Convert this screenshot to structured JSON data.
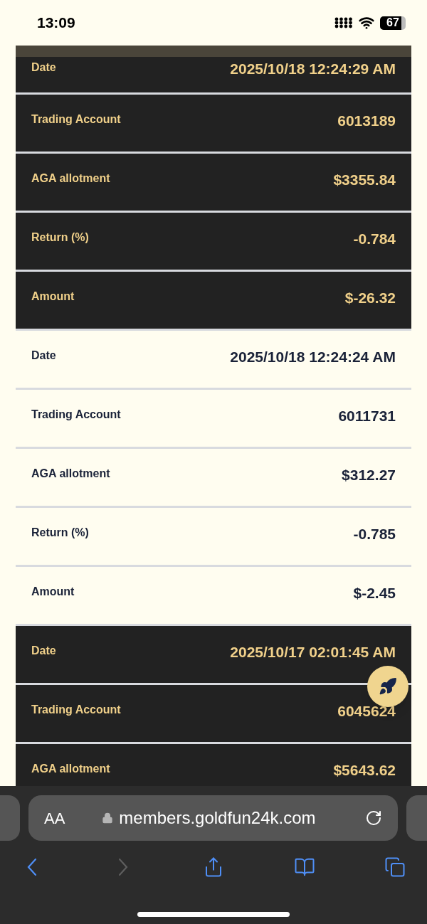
{
  "status_bar": {
    "time": "13:09",
    "battery": "67"
  },
  "records": [
    {
      "shaded": true,
      "fields": [
        {
          "label": "Date",
          "value": "2025/10/18 12:24:29 AM"
        },
        {
          "label": "Trading Account",
          "value": "6013189"
        },
        {
          "label": "AGA allotment",
          "value": "$3355.84"
        },
        {
          "label": "Return (%)",
          "value": "-0.784"
        },
        {
          "label": "Amount",
          "value": "$-26.32"
        }
      ]
    },
    {
      "shaded": false,
      "fields": [
        {
          "label": "Date",
          "value": "2025/10/18 12:24:24 AM"
        },
        {
          "label": "Trading Account",
          "value": "6011731"
        },
        {
          "label": "AGA allotment",
          "value": "$312.27"
        },
        {
          "label": "Return (%)",
          "value": "-0.785"
        },
        {
          "label": "Amount",
          "value": "$-2.45"
        }
      ]
    },
    {
      "shaded": true,
      "fields": [
        {
          "label": "Date",
          "value": "2025/10/17 02:01:45 AM"
        },
        {
          "label": "Trading Account",
          "value": "6045624"
        },
        {
          "label": "AGA allotment",
          "value": "$5643.62"
        }
      ]
    }
  ],
  "browser": {
    "text_size": "AA",
    "url": "members.goldfun24k.com",
    "toolbar": [
      {
        "kind": "back",
        "disabled": false
      },
      {
        "kind": "forward",
        "disabled": true
      },
      {
        "kind": "share",
        "disabled": false
      },
      {
        "kind": "bookmarks",
        "disabled": false
      },
      {
        "kind": "tabs",
        "disabled": false
      }
    ]
  }
}
